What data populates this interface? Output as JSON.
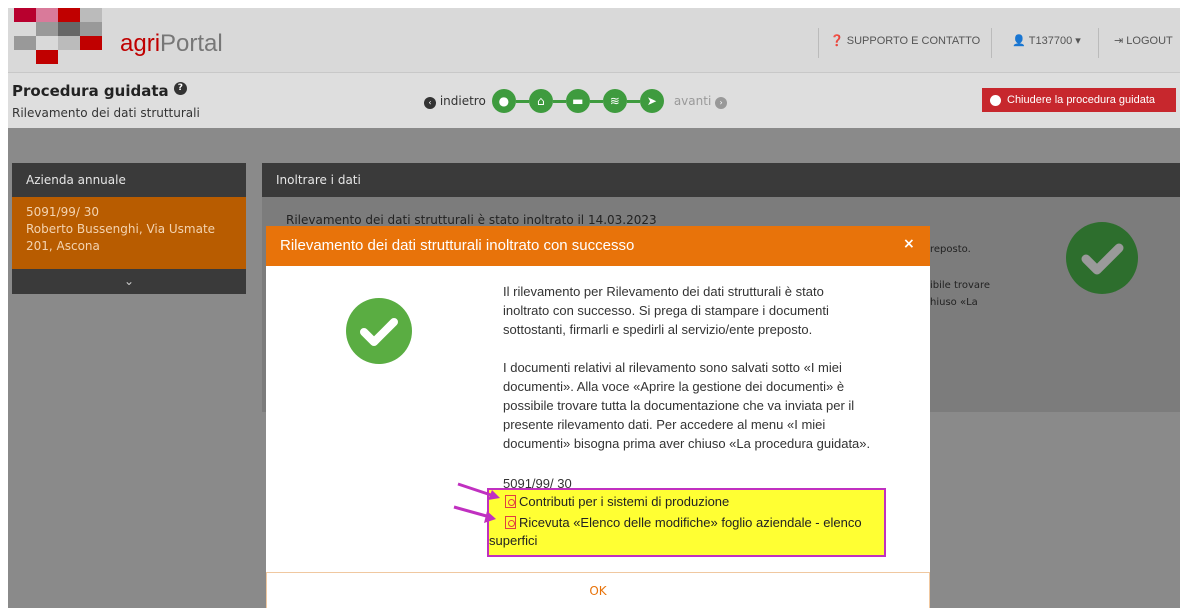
{
  "header": {
    "logo_agri": "agri",
    "logo_portal": "Portal",
    "support": "SUPPORTO E CONTATTO",
    "user": "T137700",
    "logout": "LOGOUT"
  },
  "subheader": {
    "title": "Procedura guidata",
    "subtitle": "Rilevamento dei dati strutturali",
    "back": "indietro",
    "forward": "avanti",
    "close_button": "Chiudere la procedura guidata"
  },
  "left_panel": {
    "title": "Azienda annuale",
    "line1": "5091/99/ 30",
    "line2": "Roberto Bussenghi, Via Usmate",
    "line3": "201, Ascona"
  },
  "right_panel": {
    "title": "Inoltrare i dati",
    "heading": "Rilevamento dei dati strutturali è stato inoltrato il 14.03.2023",
    "side1": "reposto.",
    "side2": "ibile trovare",
    "side3": "hiuso «La"
  },
  "modal": {
    "title": "Rilevamento dei dati strutturali inoltrato con successo",
    "close": "×",
    "p1_l1": "Il rilevamento per Rilevamento dei dati strutturali è stato",
    "p1_l2": "inoltrato con successo. Si prega di stampare i documenti",
    "p1_l3": "sottostanti, firmarli e spedirli al servizio/ente preposto.",
    "p2_l1": "I documenti relativi al rilevamento sono salvati sotto «I miei",
    "p2_l2": "documenti». Alla voce «Aprire la gestione dei documenti» è",
    "p2_l3": "possibile trovare tutta la documentazione che va inviata per il",
    "p2_l4": "presente rilevamento dati. Per accedere al menu «I miei",
    "p2_l5": "documenti» bisogna prima aver chiuso «La procedura guidata».",
    "farm_id": "5091/99/ 30",
    "doc1": "Contributi per i sistemi di produzione",
    "doc2_l1": "Ricevuta «Elenco delle modifiche» foglio aziendale - elenco",
    "doc2_l2": "superfici",
    "ok": "OK"
  },
  "colors": {
    "accent_orange": "#e8730a",
    "success_green": "#5aad42",
    "step_green": "#3e9b3e",
    "close_red": "#c7272d",
    "highlight_yellow": "#ffff33",
    "highlight_border": "#c030c0"
  }
}
